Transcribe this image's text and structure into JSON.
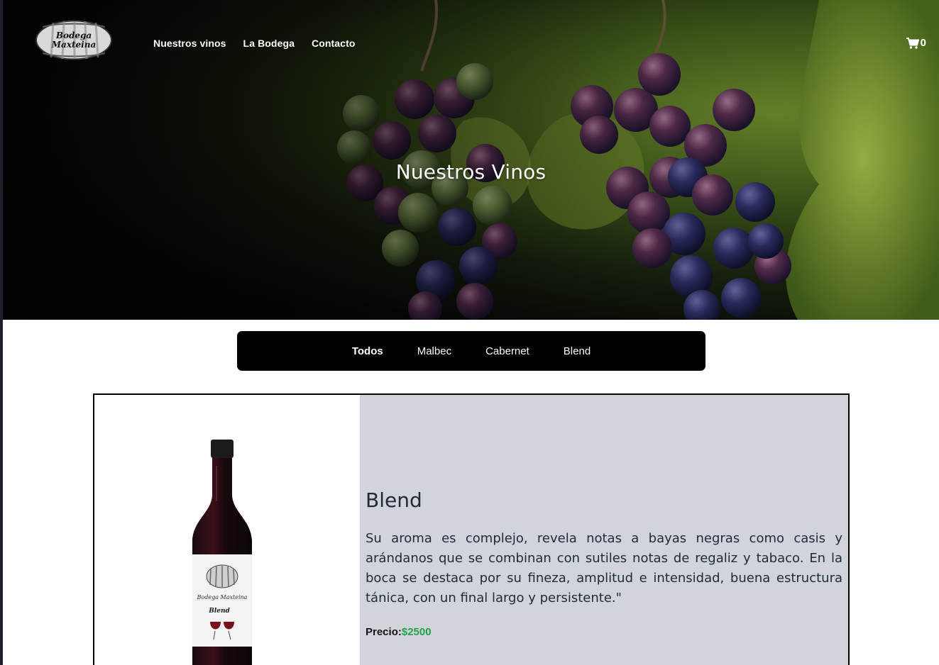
{
  "brand": {
    "logo_line1": "Bodega",
    "logo_line2": "Maxteina"
  },
  "nav": {
    "items": [
      "Nuestros vinos",
      "La Bodega",
      "Contacto"
    ]
  },
  "cart": {
    "icon": "cart-icon",
    "count": "0"
  },
  "hero": {
    "title": "Nuestros Vinos"
  },
  "filters": {
    "items": [
      "Todos",
      "Malbec",
      "Cabernet",
      "Blend"
    ],
    "active": "Todos"
  },
  "product": {
    "name": "Blend",
    "description": "Su aroma es complejo, revela notas a bayas negras como casis y arándanos que se combinan con sutiles notas de regaliz y tabaco. En la boca se destaca por su fineza, amplitud e intensidad, buena estructura tánica, con un final largo y persistente.\"",
    "price_label": "Precio:",
    "price_value": "$2500",
    "label_brand": "Bodega Maxteina",
    "label_name": "Blend"
  },
  "colors": {
    "price": "#22a04b",
    "card_info_bg": "#d1d5db",
    "filter_bg": "#000000"
  }
}
